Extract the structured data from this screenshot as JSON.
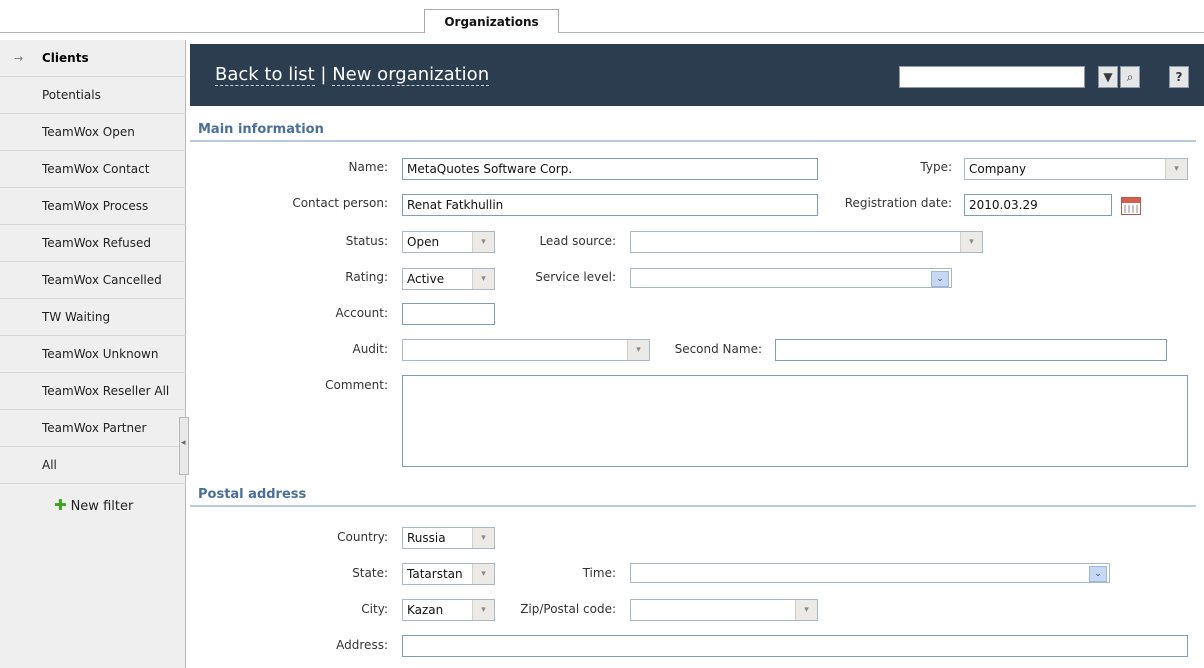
{
  "tabs": {
    "active": "Organizations"
  },
  "sidebar": {
    "arrow": "→",
    "items": [
      {
        "label": "Clients"
      },
      {
        "label": "Potentials"
      },
      {
        "label": "TeamWox Open"
      },
      {
        "label": "TeamWox Contact"
      },
      {
        "label": "TeamWox Process"
      },
      {
        "label": "TeamWox Refused"
      },
      {
        "label": "TeamWox Cancelled"
      },
      {
        "label": "TW Waiting"
      },
      {
        "label": "TeamWox Unknown"
      },
      {
        "label": "TeamWox Reseller All"
      },
      {
        "label": "TeamWox Partner"
      },
      {
        "label": "All"
      }
    ],
    "new_filter": "New filter"
  },
  "header": {
    "back_link": "Back to list",
    "separator": "|",
    "title": "New organization",
    "search_value": "",
    "help": "?"
  },
  "main_info": {
    "title": "Main information",
    "name_label": "Name:",
    "name_value": "MetaQuotes Software Corp.",
    "type_label": "Type:",
    "type_value": "Company",
    "contact_label": "Contact person:",
    "contact_value": "Renat Fatkhullin",
    "regdate_label": "Registration date:",
    "regdate_value": "2010.03.29",
    "status_label": "Status:",
    "status_value": "Open",
    "lead_label": "Lead source:",
    "lead_value": "",
    "rating_label": "Rating:",
    "rating_value": "Active",
    "service_label": "Service level:",
    "service_value": "",
    "account_label": "Account:",
    "account_value": "",
    "audit_label": "Audit:",
    "audit_value": "",
    "second_name_label": "Second Name:",
    "second_name_value": "",
    "comment_label": "Comment:",
    "comment_value": ""
  },
  "postal": {
    "title": "Postal address",
    "country_label": "Country:",
    "country_value": "Russia",
    "state_label": "State:",
    "state_value": "Tatarstan",
    "time_label": "Time:",
    "time_value": "",
    "city_label": "City:",
    "city_value": "Kazan",
    "zip_label": "Zip/Postal code:",
    "zip_value": "",
    "address_label": "Address:",
    "address_value": ""
  },
  "icons": {
    "dropdown": "▾",
    "dropdown_blue": "⌄",
    "filter": "▼",
    "search": "⌕",
    "plus": "✚",
    "collapse": "◂"
  }
}
